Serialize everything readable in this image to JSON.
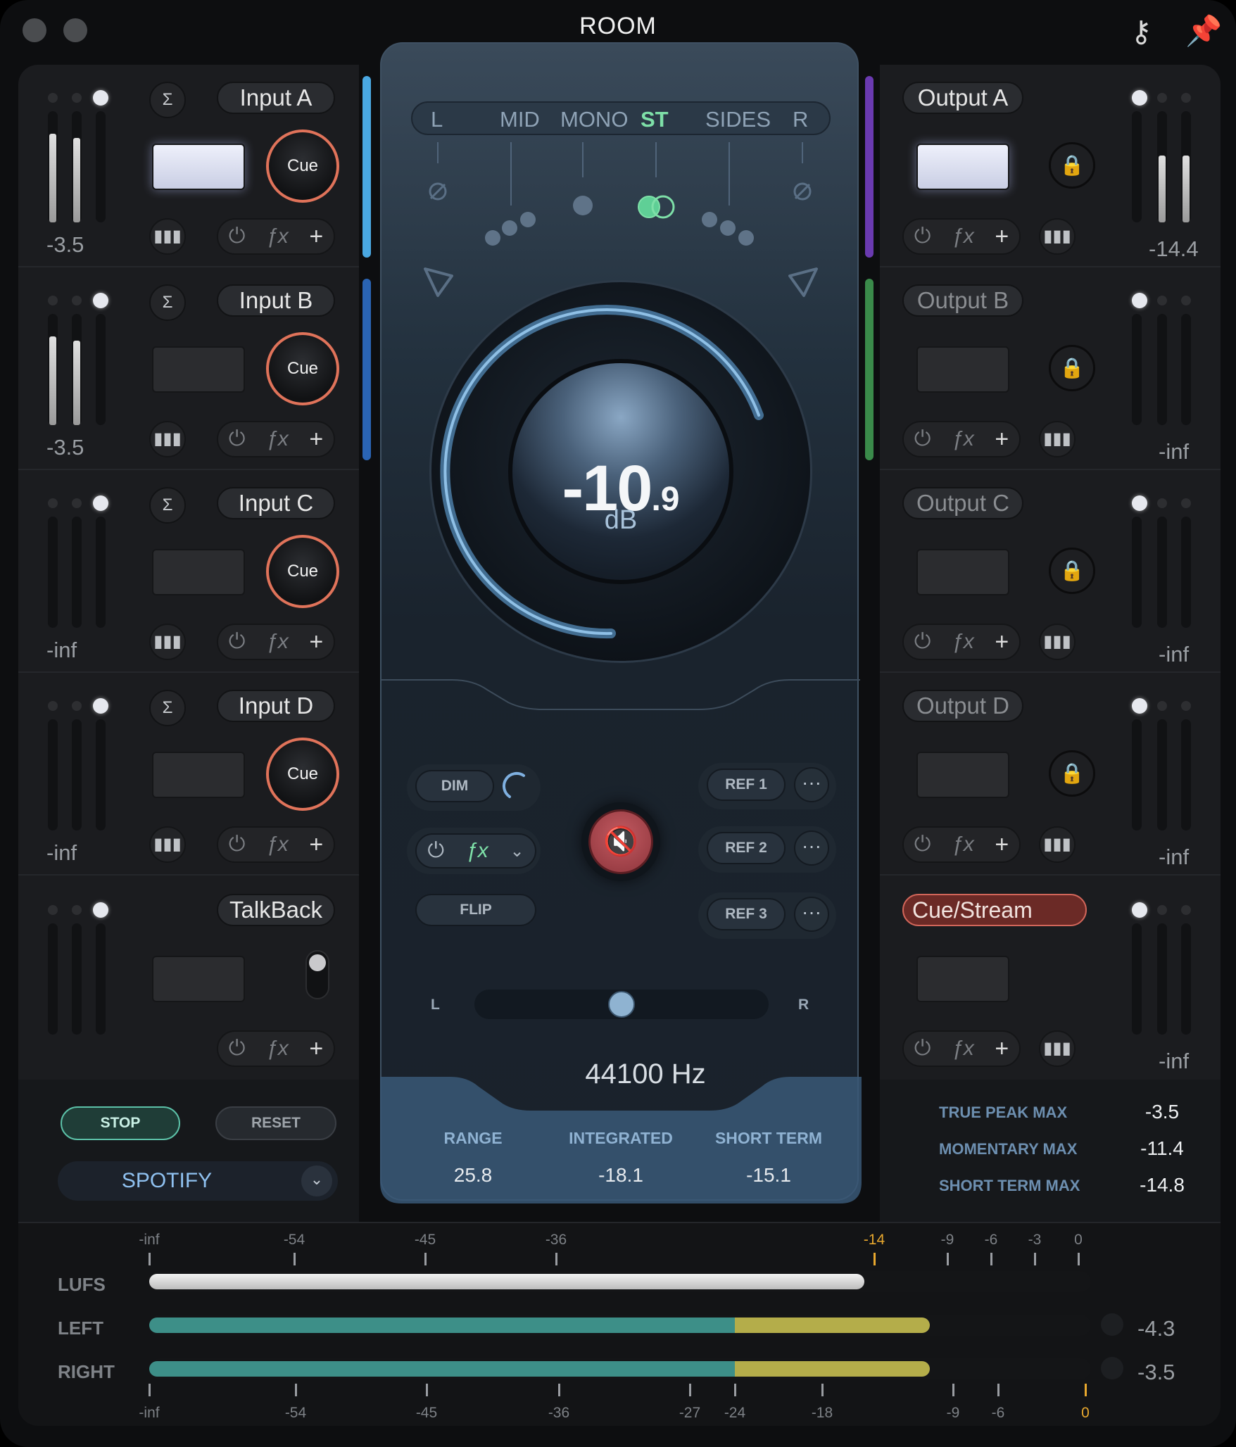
{
  "window": {
    "title": "ROOM"
  },
  "inputs": [
    {
      "name": "Input A",
      "cue": "Cue",
      "level": "-3.5",
      "swatch_lit": true,
      "meter": [
        0.82,
        0.78
      ]
    },
    {
      "name": "Input B",
      "cue": "Cue",
      "level": "-3.5",
      "swatch_lit": false,
      "meter": [
        0.82,
        0.78
      ]
    },
    {
      "name": "Input C",
      "cue": "Cue",
      "level": "-inf",
      "swatch_lit": false,
      "meter": [
        0,
        0
      ]
    },
    {
      "name": "Input D",
      "cue": "Cue",
      "level": "-inf",
      "swatch_lit": false,
      "meter": [
        0,
        0
      ]
    }
  ],
  "talkback": {
    "name": "TalkBack"
  },
  "outputs": [
    {
      "name": "Output A",
      "level": "-14.4",
      "swatch_lit": true,
      "meter": [
        0.62,
        0.62
      ]
    },
    {
      "name": "Output B",
      "level": "-inf",
      "swatch_lit": false,
      "meter": [
        0,
        0
      ]
    },
    {
      "name": "Output C",
      "level": "-inf",
      "swatch_lit": false,
      "meter": [
        0,
        0
      ]
    },
    {
      "name": "Output D",
      "level": "-inf",
      "swatch_lit": false,
      "meter": [
        0,
        0
      ]
    }
  ],
  "cue_stream": {
    "name": "Cue/Stream",
    "level": "-inf"
  },
  "accent_colors": {
    "input_a": "#4aa8e2",
    "input_b": "#2a64b4",
    "output_a": "#6a3ab0",
    "output_b": "#3a8a4a"
  },
  "modes": {
    "items": [
      "L",
      "MID",
      "MONO",
      "ST",
      "SIDES",
      "R"
    ],
    "active": "ST"
  },
  "volume": {
    "main": "-10",
    "decimal": ".9",
    "unit": "dB"
  },
  "controls": {
    "dim": "DIM",
    "flip": "FLIP",
    "refs": [
      "REF 1",
      "REF 2",
      "REF 3"
    ],
    "more": "···",
    "balance_left": "L",
    "balance_right": "R",
    "balance": 0.5
  },
  "sample_rate": "44100 Hz",
  "loudness": {
    "labels": [
      "RANGE",
      "INTEGRATED",
      "SHORT TERM"
    ],
    "values": [
      "25.8",
      "-18.1",
      "-15.1"
    ]
  },
  "transport": {
    "stop": "STOP",
    "reset": "RESET",
    "preset": "SPOTIFY"
  },
  "stats": [
    {
      "label": "TRUE PEAK MAX",
      "value": "-3.5"
    },
    {
      "label": "MOMENTARY MAX",
      "value": "-11.4"
    },
    {
      "label": "SHORT TERM MAX",
      "value": "-14.8"
    }
  ],
  "bottom_meter": {
    "top_scale": [
      "-inf",
      "-54",
      "-45",
      "-36",
      "-14",
      "-9",
      "-6",
      "-3",
      "0"
    ],
    "top_highlight": "-14",
    "bottom_scale": [
      "-inf",
      "-54",
      "-45",
      "-36",
      "-27",
      "-24",
      "-18",
      "-9",
      "-6",
      "0"
    ],
    "bottom_highlight": "0",
    "lanes": [
      {
        "label": "LUFS",
        "value": "",
        "fill": 0.77
      },
      {
        "label": "LEFT",
        "value": "-4.3",
        "fill": 0.84
      },
      {
        "label": "RIGHT",
        "value": "-3.5",
        "fill": 0.84
      }
    ]
  },
  "colors": {
    "cue_ring": "#e0735a",
    "mode_active": "#7ee0a8",
    "meter_green": "#3d8f88",
    "meter_yellow": "#b4ad4a",
    "scale_highlight": "#e8a82e",
    "mute": "#b0454d"
  }
}
